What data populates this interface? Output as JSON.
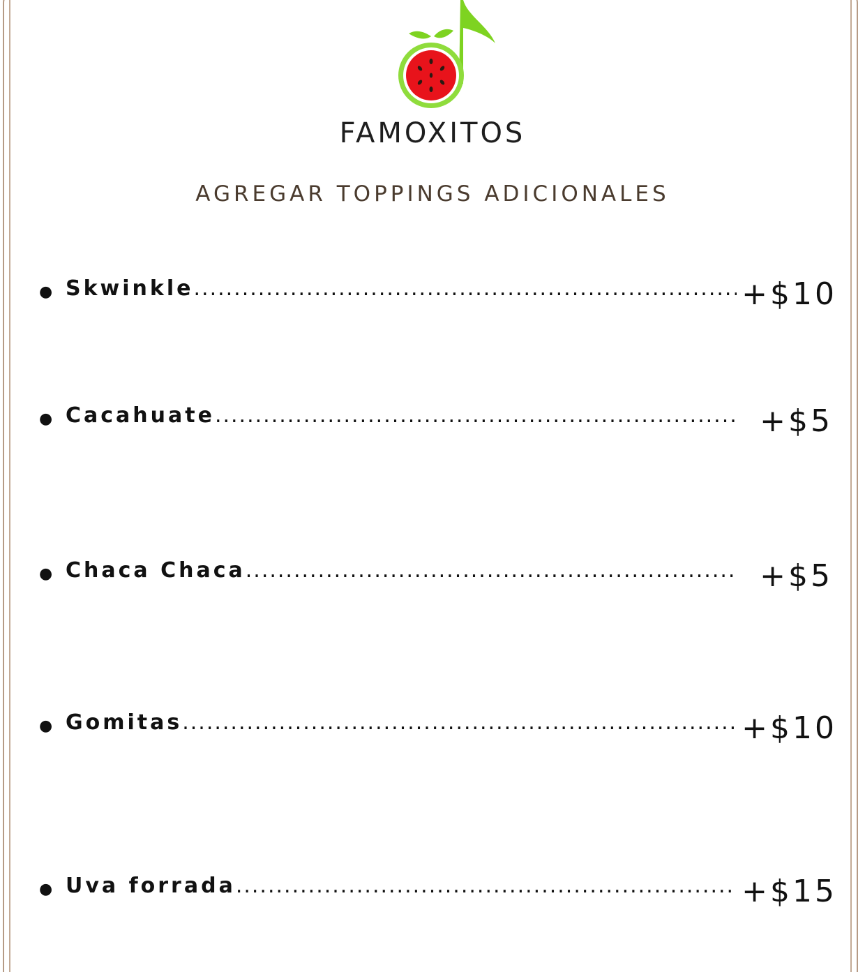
{
  "brand": {
    "name": "FAMOXITOS"
  },
  "menu": {
    "title": "AGREGAR TOPPINGS ADICIONALES",
    "dots": "..............................................................................................................................................................",
    "items": [
      {
        "name": "Skwinkle",
        "price": "+$10"
      },
      {
        "name": "Cacahuate",
        "price": "+$5"
      },
      {
        "name": "Chaca Chaca",
        "price": "+$5"
      },
      {
        "name": "Gomitas",
        "price": "+$10"
      },
      {
        "name": "Uva forrada",
        "price": "+$15"
      }
    ]
  },
  "colors": {
    "accent_green": "#7ed321",
    "watermelon_red": "#e8131b",
    "frame_brown": "#b59a85"
  },
  "icons": {
    "logo": "watermelon-music-note-logo",
    "bullet": "bullet-dot-icon"
  }
}
